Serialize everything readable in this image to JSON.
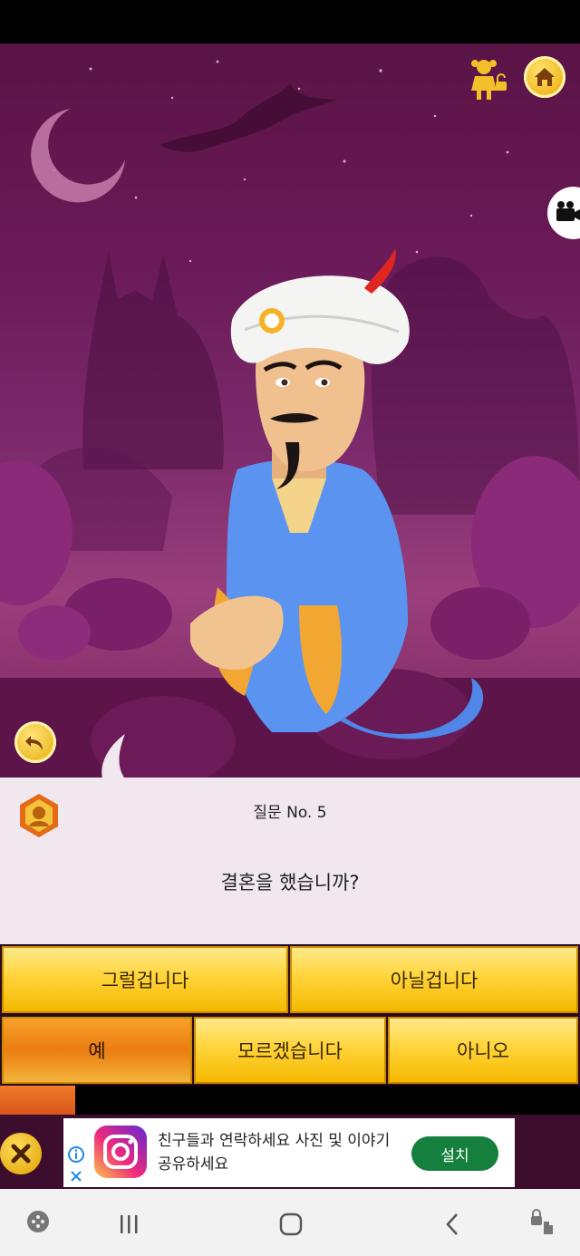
{
  "question": {
    "number_label": "질문 No. 5",
    "text": "결혼을 했습니까?"
  },
  "answers": {
    "probably": "그럴겁니다",
    "probably_not": "아닐겁니다",
    "yes": "예",
    "dont_know": "모르겠습니다",
    "no": "아니오",
    "selected": "yes"
  },
  "progress": {
    "fraction": 0.13
  },
  "ad": {
    "text": "친구들과 연락하세요 사진 및 이야기 공유하세요",
    "install_label": "설치",
    "app_icon": "instagram-icon"
  },
  "icons": {
    "top_left_toggle": "girl-lock-icon",
    "home": "home-icon",
    "camera": "video-camera-icon",
    "undo": "undo-arrow-icon",
    "close_ad": "close-x-icon"
  },
  "colors": {
    "scene_purple": "#6a1a58",
    "button_gold": "#ffd43a",
    "button_selected": "#ec7d12",
    "panel": "#f0e7ef",
    "install_green": "#15803d"
  }
}
